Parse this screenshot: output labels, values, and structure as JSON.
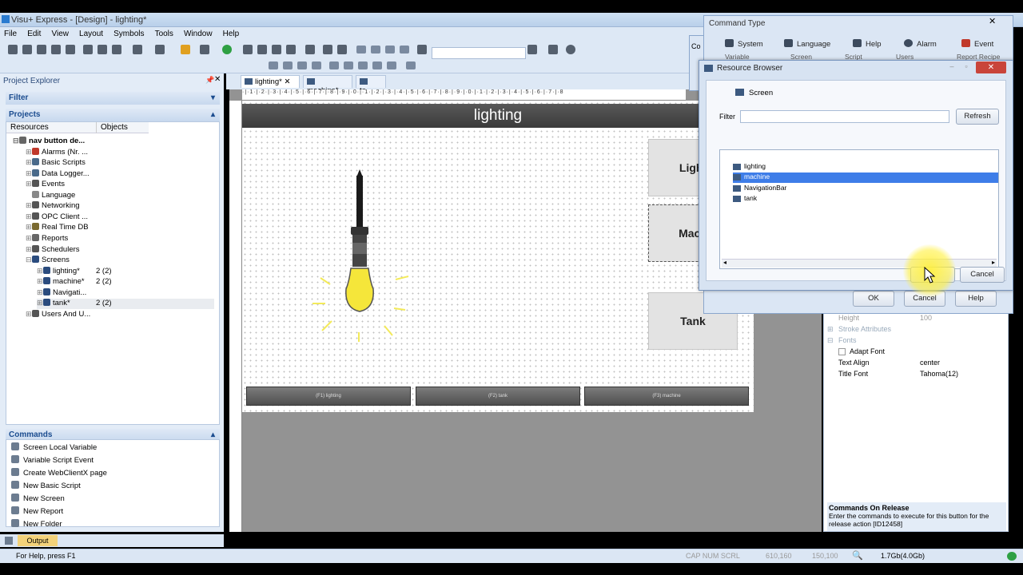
{
  "window": {
    "title": "Visu+ Express - [Design] - lighting*"
  },
  "menu": [
    "File",
    "Edit",
    "View",
    "Layout",
    "Symbols",
    "Tools",
    "Window",
    "Help"
  ],
  "project_explorer": {
    "title": "Project Explorer",
    "filter_label": "Filter",
    "projects_label": "Projects",
    "col_resources": "Resources",
    "col_objects": "Objects",
    "root": "nav button de...",
    "items": [
      {
        "label": "Alarms (Nr. ...",
        "icon": "alarm-icon"
      },
      {
        "label": "Basic Scripts",
        "icon": "script-icon"
      },
      {
        "label": "Data Logger...",
        "icon": "datalogger-icon"
      },
      {
        "label": "Events",
        "icon": "events-icon"
      },
      {
        "label": "Language",
        "icon": "language-icon"
      },
      {
        "label": "Networking",
        "icon": "network-icon"
      },
      {
        "label": "OPC Client ...",
        "icon": "opc-icon"
      },
      {
        "label": "Real Time DB",
        "icon": "database-icon"
      },
      {
        "label": "Reports",
        "icon": "report-icon"
      },
      {
        "label": "Schedulers",
        "icon": "scheduler-icon"
      },
      {
        "label": "Screens",
        "icon": "screen-icon"
      },
      {
        "label": "Users And U...",
        "icon": "users-icon"
      }
    ],
    "screens": [
      {
        "label": "lighting*",
        "objects": "2 (2)"
      },
      {
        "label": "machine*",
        "objects": "2 (2)"
      },
      {
        "label": "Navigati...",
        "objects": ""
      },
      {
        "label": "tank*",
        "objects": "2 (2)"
      }
    ]
  },
  "commands": {
    "title": "Commands",
    "items": [
      "Screen Local Variable",
      "Variable Script Event",
      "Create WebClientX page",
      "New Basic Script",
      "New Screen",
      "New Report",
      "New Folder"
    ]
  },
  "tabs": [
    "lighting*",
    "machine*",
    "ta..."
  ],
  "canvas": {
    "title": "lighting",
    "side_buttons": [
      "Light",
      "Mach",
      "Tank"
    ],
    "nav_buttons": [
      "(F1) lighting",
      "(F2) tank",
      "(F3) machine"
    ]
  },
  "command_type": {
    "title": "Command Type",
    "tabs_row1": [
      "System",
      "Language",
      "Help",
      "Alarm",
      "Event"
    ],
    "tabs_row2": [
      "Variable",
      "Screen",
      "Script",
      "Users",
      "Report Recipe"
    ],
    "ok": "OK",
    "cancel": "Cancel",
    "help": "Help",
    "side_cut": "Co"
  },
  "resource_browser": {
    "title": "Resource Browser",
    "tab": "Screen",
    "filter_label": "Filter",
    "filter_value": "",
    "refresh": "Refresh",
    "items": [
      "lighting",
      "machine",
      "NavigationBar",
      "tank"
    ],
    "selected_index": 1,
    "cancel": "Cancel"
  },
  "properties": {
    "rows": [
      {
        "k": "Height",
        "v": "100"
      },
      {
        "k": "Stroke Attributes",
        "v": ""
      },
      {
        "k": "Fonts",
        "v": ""
      },
      {
        "k": "Adapt Font",
        "v": ""
      },
      {
        "k": "Text Align",
        "v": "center"
      },
      {
        "k": "Title Font",
        "v": "Tahoma(12)"
      }
    ],
    "help_title": "Commands On Release",
    "help_text": "Enter the commands to execute for this button for the release action [ID12458]"
  },
  "output_tab": "Output",
  "status": {
    "help": "For Help, press F1",
    "caps": "CAP NUM SCRL",
    "pos": "610,160",
    "size": "150,100",
    "mem": "1.7Gb(4.0Gb)"
  }
}
